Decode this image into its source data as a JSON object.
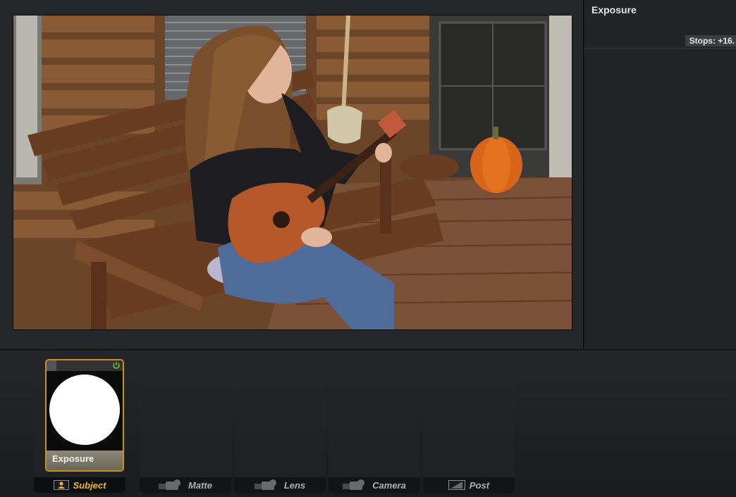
{
  "inspector": {
    "title": "Exposure",
    "stops_label": "Stops: +16."
  },
  "stack": {
    "tile": {
      "caption": "Exposure",
      "thumb_icon": "exposure-circle-icon",
      "power_icon": "power-icon"
    },
    "slots": [
      {
        "label": "Subject",
        "icon": "subject-icon",
        "active": true
      },
      {
        "label": "Matte",
        "icon": "camera-icon",
        "active": false
      },
      {
        "label": "Lens",
        "icon": "camera-icon",
        "active": false
      },
      {
        "label": "Camera",
        "icon": "camera-icon",
        "active": false
      },
      {
        "label": "Post",
        "icon": "post-icon",
        "active": false
      }
    ]
  },
  "colors": {
    "accent": "#f1b71c",
    "tile_border": "#c9921e",
    "power": "#6fbf3a",
    "panel": "#26272a"
  }
}
